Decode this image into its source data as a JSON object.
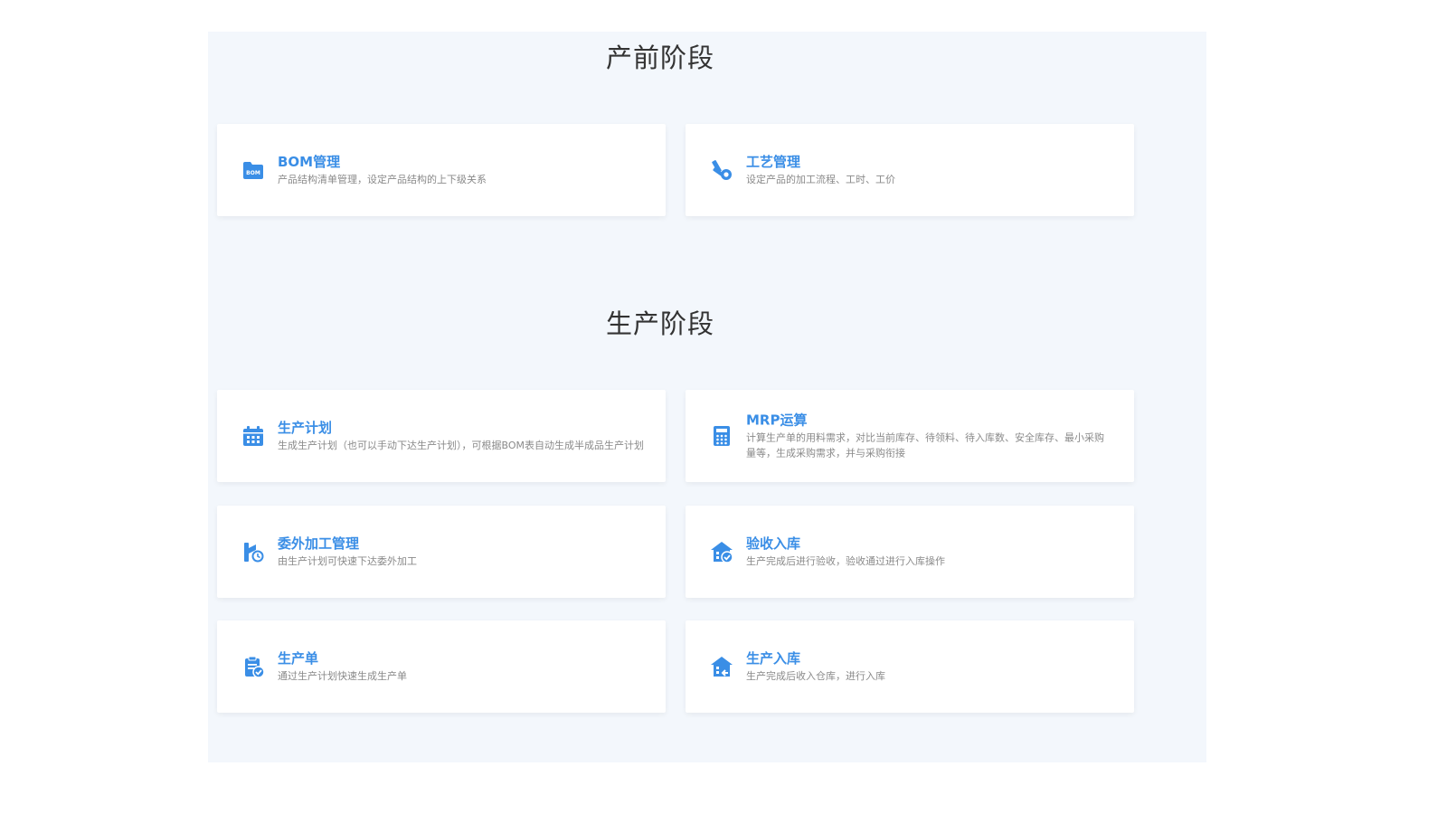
{
  "colors": {
    "accent": "#3a8ee6",
    "panel_bg": "#f3f7fc",
    "title_text": "#333333",
    "desc_text": "#8a8a8a"
  },
  "sections": [
    {
      "title": "产前阶段",
      "cards": [
        {
          "icon": "bom-folder-icon",
          "title": "BOM管理",
          "desc": "产品结构清单管理，设定产品结构的上下级关系"
        },
        {
          "icon": "process-tools-icon",
          "title": "工艺管理",
          "desc": "设定产品的加工流程、工时、工价"
        }
      ]
    },
    {
      "title": "生产阶段",
      "cards": [
        {
          "icon": "calendar-plan-icon",
          "title": "生产计划",
          "desc": "生成生产计划（也可以手动下达生产计划），可根据BOM表自动生成半成品生产计划"
        },
        {
          "icon": "calculator-icon",
          "title": "MRP运算",
          "desc": "计算生产单的用料需求，对比当前库存、待领料、待入库数、安全库存、最小采购量等，生成采购需求，并与采购衔接"
        },
        {
          "icon": "outsource-icon",
          "title": "委外加工管理",
          "desc": "由生产计划可快速下达委外加工"
        },
        {
          "icon": "warehouse-check-icon",
          "title": "验收入库",
          "desc": "生产完成后进行验收，验收通过进行入库操作"
        },
        {
          "icon": "clipboard-check-icon",
          "title": "生产单",
          "desc": "通过生产计划快速生成生产单"
        },
        {
          "icon": "warehouse-in-icon",
          "title": "生产入库",
          "desc": "生产完成后收入仓库，进行入库"
        }
      ]
    }
  ]
}
